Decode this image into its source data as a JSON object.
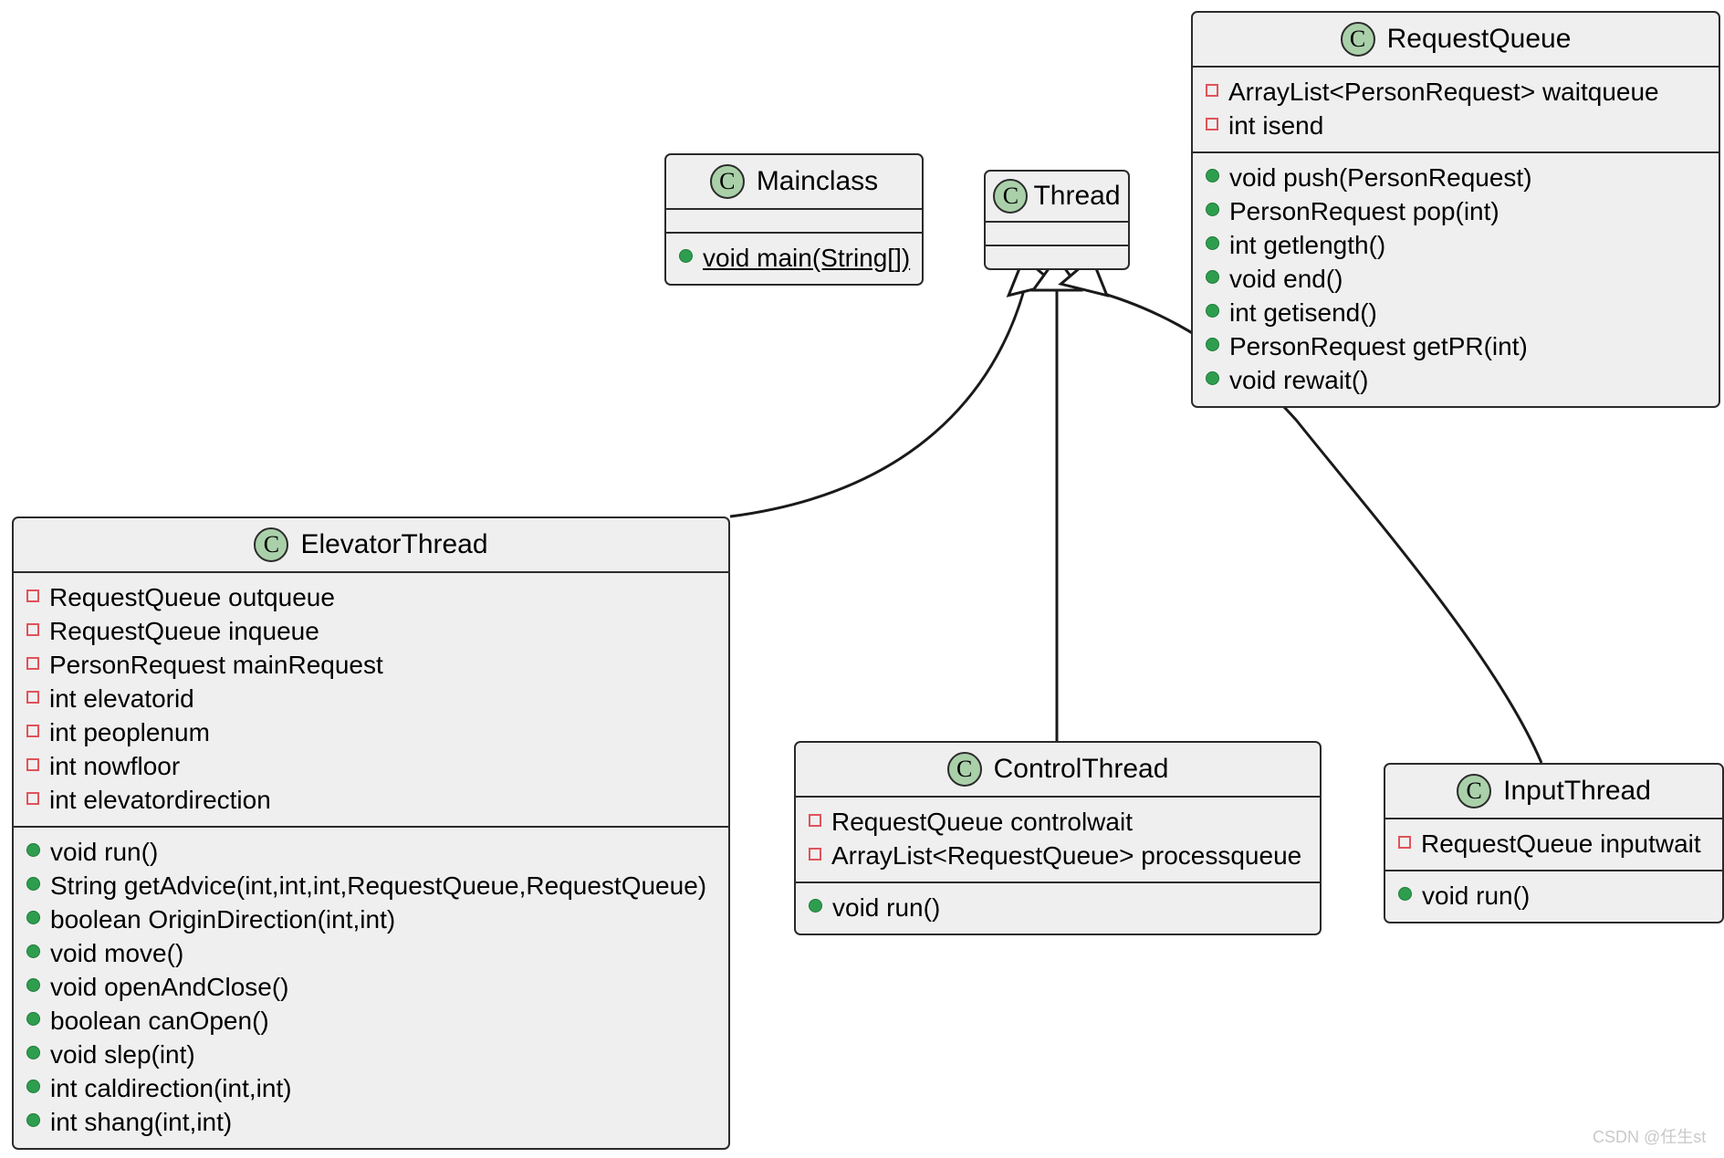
{
  "diagram": {
    "type": "uml-class-diagram",
    "watermark": "CSDN @任生st",
    "colors": {
      "box_fill": "#efefef",
      "box_border": "#2b2b2b",
      "class_badge_fill": "#aad0aa",
      "field_marker": "#e0535a",
      "method_marker": "#2e9e4e",
      "canvas": "#ffffff",
      "watermark_text": "#c9c9c9"
    },
    "classes": [
      {
        "id": "requestqueue",
        "name": "RequestQueue",
        "badge": "C",
        "fields": [
          "ArrayList<PersonRequest> waitqueue",
          "int isend"
        ],
        "methods": [
          "void push(PersonRequest)",
          "PersonRequest pop(int)",
          "int getlength()",
          "void end()",
          "int getisend()",
          "PersonRequest getPR(int)",
          "void rewait()"
        ]
      },
      {
        "id": "mainclass",
        "name": "Mainclass",
        "badge": "C",
        "fields": [],
        "methods": [
          "void main(String[])"
        ],
        "static_methods": [
          "void main(String[])"
        ]
      },
      {
        "id": "thread",
        "name": "Thread",
        "badge": "C",
        "fields": [],
        "methods": []
      },
      {
        "id": "elevator",
        "name": "ElevatorThread",
        "badge": "C",
        "fields": [
          "RequestQueue outqueue",
          "RequestQueue inqueue",
          "PersonRequest mainRequest",
          "int elevatorid",
          "int peoplenum",
          "int nowfloor",
          "int elevatordirection"
        ],
        "methods": [
          "void run()",
          "String getAdvice(int,int,int,RequestQueue,RequestQueue)",
          "boolean OriginDirection(int,int)",
          "void move()",
          "void openAndClose()",
          "boolean canOpen()",
          "void slep(int)",
          "int caldirection(int,int)",
          "int shang(int,int)"
        ]
      },
      {
        "id": "control",
        "name": "ControlThread",
        "badge": "C",
        "fields": [
          "RequestQueue controlwait",
          "ArrayList<RequestQueue> processqueue"
        ],
        "methods": [
          "void run()"
        ]
      },
      {
        "id": "input",
        "name": "InputThread",
        "badge": "C",
        "fields": [
          "RequestQueue inputwait"
        ],
        "methods": [
          "void run()"
        ]
      }
    ],
    "relationships": [
      {
        "type": "generalization",
        "from": "ElevatorThread",
        "to": "Thread"
      },
      {
        "type": "generalization",
        "from": "ControlThread",
        "to": "Thread"
      },
      {
        "type": "generalization",
        "from": "InputThread",
        "to": "Thread"
      }
    ]
  }
}
